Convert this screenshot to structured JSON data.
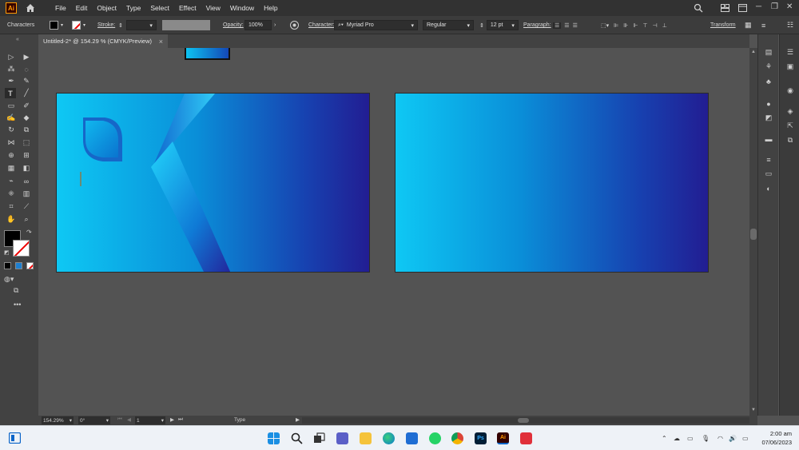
{
  "app": {
    "logo": "Ai",
    "menus": [
      "File",
      "Edit",
      "Object",
      "Type",
      "Select",
      "Effect",
      "View",
      "Window",
      "Help"
    ]
  },
  "controlbar": {
    "panel_label": "Characters",
    "stroke_label": "Stroke:",
    "opacity_label": "Opacity:",
    "opacity_value": "100%",
    "character_label": "Character:",
    "font_family": "Myriad Pro",
    "font_style": "Regular",
    "font_size": "12 pt",
    "paragraph_label": "Paragraph:",
    "transform_label": "Transform"
  },
  "document": {
    "tab_title": "Untitled-2* @ 154.29 % (CMYK/Preview)",
    "close_glyph": "×"
  },
  "status": {
    "zoom": "154.29%",
    "rotation": "0°",
    "artboard": "1",
    "tool": "Type"
  },
  "taskbar": {
    "time": "2:00 am",
    "date": "07/06/2023"
  },
  "colors": {
    "gradient_start": "#0ec8f4",
    "gradient_mid": "#0a8ed8",
    "gradient_end": "#221d92",
    "ui_dark": "#323232",
    "ui_panel": "#424242",
    "canvas_bg": "#535353"
  }
}
